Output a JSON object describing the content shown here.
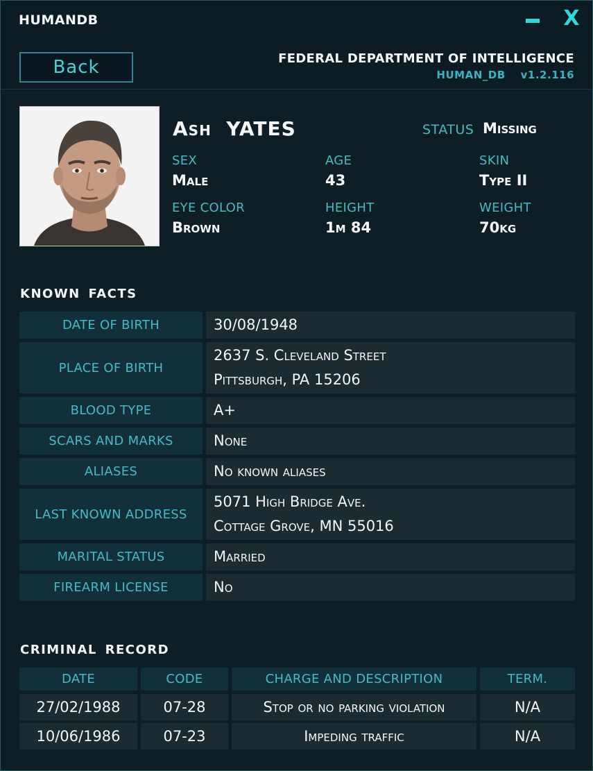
{
  "window": {
    "app_title": "HUMANDB",
    "minimize_label": "",
    "close_label": "X"
  },
  "header": {
    "back_label": "Back",
    "agency": "FEDERAL DEPARTMENT OF INTELLIGENCE",
    "db_name": "HUMAN_DB",
    "version": "v1.2.116"
  },
  "profile": {
    "first_name": "Ash",
    "last_name": "YATES",
    "status_label": "STATUS",
    "status_value": "Missing",
    "attributes": [
      {
        "label": "SEX",
        "value": "Male"
      },
      {
        "label": "AGE",
        "value": "43"
      },
      {
        "label": "SKIN",
        "value": "Type II"
      },
      {
        "label": "EYE COLOR",
        "value": "Brown"
      },
      {
        "label": "HEIGHT",
        "value": "1m 84"
      },
      {
        "label": "WEIGHT",
        "value": "70kg"
      }
    ]
  },
  "known_facts": {
    "title": "KNOWN FACTS",
    "rows": [
      {
        "label": "DATE OF BIRTH",
        "lines": [
          "30/08/1948"
        ]
      },
      {
        "label": "PLACE OF BIRTH",
        "lines": [
          "2637 S. Cleveland Street",
          "Pittsburgh, PA 15206"
        ]
      },
      {
        "label": "BLOOD TYPE",
        "lines": [
          "A+"
        ]
      },
      {
        "label": "SCARS AND MARKS",
        "lines": [
          "None"
        ]
      },
      {
        "label": "ALIASES",
        "lines": [
          "No known aliases"
        ]
      },
      {
        "label": "LAST KNOWN ADDRESS",
        "lines": [
          "5071 High Bridge Ave.",
          "Cottage Grove, MN 55016"
        ]
      },
      {
        "label": "MARITAL STATUS",
        "lines": [
          "Married"
        ]
      },
      {
        "label": "FIREARM LICENSE",
        "lines": [
          "No"
        ]
      }
    ]
  },
  "criminal_record": {
    "title": "CRIMINAL RECORD",
    "columns": [
      "DATE",
      "CODE",
      "CHARGE AND DESCRIPTION",
      "TERM."
    ],
    "rows": [
      [
        "27/02/1988",
        "07-28",
        "Stop or no parking violation",
        "N/A"
      ],
      [
        "10/06/1986",
        "07-23",
        "Impeding traffic",
        "N/A"
      ]
    ]
  },
  "colors": {
    "accent": "#48b9c4",
    "button_accent": "#34d6dc",
    "background": "#0e1e26",
    "label_cell": "#11303a",
    "value_cell": "#1b2b32"
  }
}
